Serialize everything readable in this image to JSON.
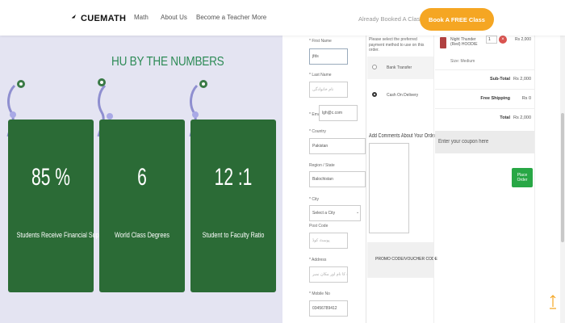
{
  "header": {
    "logo_text": "CUEMATH",
    "nav": [
      "Math",
      "About Us",
      "Become a Teacher",
      "More"
    ],
    "already_booked": "Already Booked A Class?",
    "book_button": "Book A FREE Class"
  },
  "hero": {
    "title": "HU BY THE NUMBERS",
    "cards": [
      {
        "value": "85 %",
        "label": "Students Receive Financial Support"
      },
      {
        "value": "6",
        "label": "World Class Degrees"
      },
      {
        "value": "12 :1",
        "label": "Student to Faculty Ratio"
      }
    ]
  },
  "form": {
    "first_name_label": "* First Name",
    "first_name_value": "jfds",
    "last_name_label": "* Last Name",
    "last_name_placeholder": "نام خانوادگی",
    "email_label": "* Email",
    "email_value": "lgh@c.com",
    "country_label": "* Country",
    "country_value": "Pakistan",
    "region_label": "Region / State",
    "region_value": "Balochistan",
    "city_label": "* City",
    "city_value": "Select a City",
    "postal_label": "Post Code",
    "postal_placeholder": "پوسٹ کوڈ",
    "address_label": "* Address",
    "address_placeholder": "پتہ سٹریٹ کا نام اور مکان نمبر",
    "mobile_label": "* Mobile No",
    "mobile_value": "03456789412"
  },
  "payment": {
    "note": "Please select the preferred payment method to use on this order.",
    "options": [
      {
        "label": "Bank Transfer",
        "selected": false
      },
      {
        "label": "Cash On Delivery",
        "selected": true
      }
    ],
    "comments_label": "Add Comments About Your Order",
    "code_text": "PROMO CODE/VOUCHER CODE"
  },
  "order": {
    "product_name": "Night Thunder (Red) HOODIE",
    "product_meta": "Size: Medium",
    "product_price": "Rs 2,000",
    "quantity": "1",
    "remove_icon": "×",
    "subtotal_label": "Sub-Total",
    "subtotal_value": "Rs 2,000",
    "shipping_label": "Free Shipping",
    "shipping_value": "Rs 0",
    "total_label": "Total",
    "total_value": "Rs 2,000",
    "coupon_text": "Enter your coupon here",
    "place_order": "Place Order"
  },
  "colors": {
    "card_green": "#2b6b36",
    "title_green": "#2e8b57",
    "book_orange": "#f5a623",
    "order_green": "#28a745",
    "panel_lavender": "#e4e4f2"
  }
}
